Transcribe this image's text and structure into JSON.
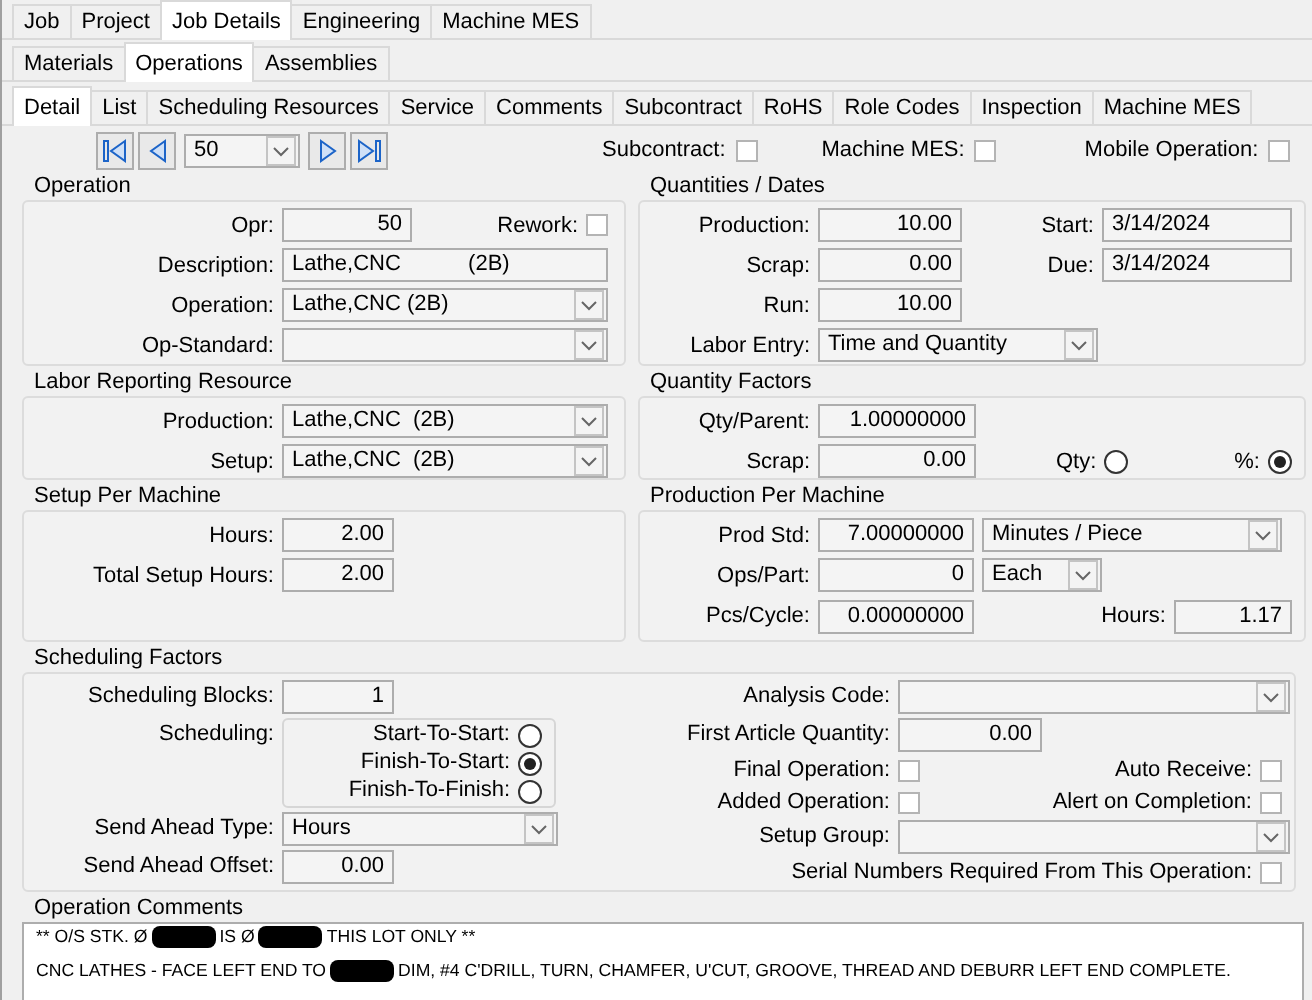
{
  "top_tabs": [
    {
      "label": "Job",
      "selected": false
    },
    {
      "label": "Project",
      "selected": false
    },
    {
      "label": "Job Details",
      "selected": true
    },
    {
      "label": "Engineering",
      "selected": false
    },
    {
      "label": "Machine MES",
      "selected": false
    }
  ],
  "sub_tabs": [
    {
      "label": "Materials",
      "selected": false
    },
    {
      "label": "Operations",
      "selected": true
    },
    {
      "label": "Assemblies",
      "selected": false
    }
  ],
  "detail_tabs": [
    {
      "label": "Detail",
      "selected": true
    },
    {
      "label": "List",
      "selected": false
    },
    {
      "label": "Scheduling Resources",
      "selected": false
    },
    {
      "label": "Service",
      "selected": false
    },
    {
      "label": "Comments",
      "selected": false
    },
    {
      "label": "Subcontract",
      "selected": false
    },
    {
      "label": "RoHS",
      "selected": false
    },
    {
      "label": "Role Codes",
      "selected": false
    },
    {
      "label": "Inspection",
      "selected": false
    },
    {
      "label": "Machine MES",
      "selected": false
    }
  ],
  "navigator": {
    "value": "50",
    "flags": [
      {
        "label": "Subcontract:",
        "checked": false
      },
      {
        "label": "Machine MES:",
        "checked": false
      },
      {
        "label": "Mobile Operation:",
        "checked": false
      }
    ]
  },
  "operation": {
    "title": "Operation",
    "opr": {
      "label": "Opr:",
      "value": "50"
    },
    "rework": {
      "label": "Rework:",
      "checked": false
    },
    "description": {
      "label": "Description:",
      "value": "Lathe,CNC           (2B)"
    },
    "operation": {
      "label": "Operation:",
      "value": "Lathe,CNC (2B)"
    },
    "op_standard": {
      "label": "Op-Standard:"
    }
  },
  "quantities_dates": {
    "title": "Quantities / Dates",
    "production": {
      "label": "Production:",
      "value": "10.00"
    },
    "start": {
      "label": "Start:",
      "value": "3/14/2024"
    },
    "scrap": {
      "label": "Scrap:",
      "value": "0.00"
    },
    "due": {
      "label": "Due:",
      "value": "3/14/2024"
    },
    "run": {
      "label": "Run:",
      "value": "10.00"
    },
    "labor_entry": {
      "label": "Labor Entry:",
      "value": "Time and Quantity"
    }
  },
  "labor_reporting_resource": {
    "title": "Labor Reporting Resource",
    "production": {
      "label": "Production:",
      "value": "Lathe,CNC  (2B)"
    },
    "setup": {
      "label": "Setup:",
      "value": "Lathe,CNC  (2B)"
    }
  },
  "quantity_factors": {
    "title": "Quantity Factors",
    "qty_per_parent": {
      "label": "Qty/Parent:",
      "value": "1.00000000"
    },
    "scrap": {
      "label": "Scrap:",
      "value": "0.00"
    },
    "scrap_basis": [
      {
        "label": "Qty:",
        "selected": false
      },
      {
        "label": "%:",
        "selected": true
      }
    ]
  },
  "setup_per_machine": {
    "title": "Setup Per Machine",
    "hours": {
      "label": "Hours:",
      "value": "2.00"
    },
    "total_setup_hours": {
      "label": "Total Setup Hours:",
      "value": "2.00"
    }
  },
  "production_per_machine": {
    "title": "Production Per Machine",
    "prod_std": {
      "label": "Prod Std:",
      "value": "7.00000000",
      "unit": "Minutes / Piece"
    },
    "ops_per_part": {
      "label": "Ops/Part:",
      "value": "0",
      "unit": "Each"
    },
    "pcs_per_cycle": {
      "label": "Pcs/Cycle:",
      "value": "0.00000000"
    },
    "hours": {
      "label": "Hours:",
      "value": "1.17"
    }
  },
  "scheduling_factors": {
    "title": "Scheduling Factors",
    "scheduling_blocks": {
      "label": "Scheduling Blocks:",
      "value": "1"
    },
    "scheduling": {
      "label": "Scheduling:",
      "options": [
        {
          "label": "Start-To-Start:",
          "selected": false
        },
        {
          "label": "Finish-To-Start:",
          "selected": true
        },
        {
          "label": "Finish-To-Finish:",
          "selected": false
        }
      ]
    },
    "send_ahead_type": {
      "label": "Send Ahead Type:",
      "value": "Hours"
    },
    "send_ahead_offset": {
      "label": "Send Ahead Offset:",
      "value": "0.00"
    },
    "analysis_code": {
      "label": "Analysis Code:"
    },
    "first_article_quantity": {
      "label": "First Article Quantity:",
      "value": "0.00"
    },
    "final_operation": {
      "label": "Final Operation:",
      "checked": false
    },
    "auto_receive": {
      "label": "Auto Receive:",
      "checked": false
    },
    "added_operation": {
      "label": "Added Operation:",
      "checked": false
    },
    "alert_on_completion": {
      "label": "Alert on Completion:",
      "checked": false
    },
    "setup_group": {
      "label": "Setup Group:"
    },
    "serial_numbers_required": {
      "label": "Serial Numbers Required From This Operation:",
      "checked": false
    }
  },
  "operation_comments": {
    "title": "Operation Comments",
    "lines": [
      {
        "segments": [
          {
            "kind": "text",
            "text": "** O/S STK. Ø"
          },
          {
            "kind": "redacted"
          },
          {
            "kind": "text",
            "text": "IS Ø"
          },
          {
            "kind": "redacted"
          },
          {
            "kind": "text",
            "text": "THIS LOT ONLY **"
          }
        ]
      },
      {
        "segments": [
          {
            "kind": "text",
            "text": "CNC LATHES - FACE LEFT END TO"
          },
          {
            "kind": "redacted"
          },
          {
            "kind": "text",
            "text": "DIM, #4 C'DRILL, TURN, CHAMFER, U'CUT, GROOVE, THREAD AND DEBURR LEFT END COMPLETE."
          }
        ]
      }
    ]
  }
}
